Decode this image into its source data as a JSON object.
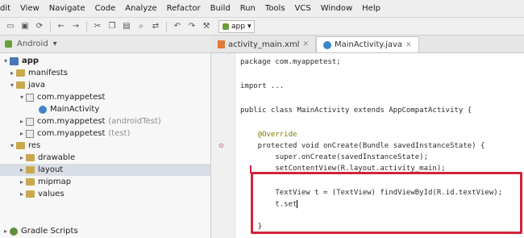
{
  "menu": [
    "dit",
    "View",
    "Navigate",
    "Code",
    "Analyze",
    "Refactor",
    "Build",
    "Run",
    "Tools",
    "VCS",
    "Window",
    "Help"
  ],
  "toolbar": {
    "run_config": "app",
    "icons": [
      "folder-icon",
      "save-icon",
      "refresh-icon",
      "back-icon",
      "forward-icon",
      "cut-icon",
      "copy-icon",
      "paste-icon",
      "find-icon",
      "replace-icon",
      "undo-icon",
      "redo-icon",
      "build-icon"
    ]
  },
  "project_panel": {
    "label": "Android"
  },
  "tabs": [
    {
      "label": "activity_main.xml",
      "active": false
    },
    {
      "label": "MainActivity.java",
      "active": true
    }
  ],
  "tree": [
    {
      "label": "app",
      "indent": 0,
      "icon": "module",
      "bold": true
    },
    {
      "label": "manifests",
      "indent": 1,
      "icon": "folder"
    },
    {
      "label": "java",
      "indent": 1,
      "icon": "folder"
    },
    {
      "label": "com.myappetest",
      "indent": 2,
      "icon": "package"
    },
    {
      "label": "MainActivity",
      "indent": 3,
      "icon": "class"
    },
    {
      "label": "com.myappetest",
      "indent": 2,
      "icon": "package",
      "suffix": "(androidTest)"
    },
    {
      "label": "com.myappetest",
      "indent": 2,
      "icon": "package",
      "suffix": "(test)"
    },
    {
      "label": "res",
      "indent": 1,
      "icon": "folder"
    },
    {
      "label": "drawable",
      "indent": 2,
      "icon": "folder"
    },
    {
      "label": "layout",
      "indent": 2,
      "icon": "folder",
      "selected": true
    },
    {
      "label": "mipmap",
      "indent": 2,
      "icon": "folder"
    },
    {
      "label": "values",
      "indent": 2,
      "icon": "folder"
    },
    {
      "label": "Gradle Scripts",
      "indent": 0,
      "icon": "gradle"
    }
  ],
  "code": [
    "package com.myappetest;",
    "",
    "import ...",
    "",
    "public class MainActivity extends AppCompatActivity {",
    "",
    "    @Override",
    "    protected void onCreate(Bundle savedInstanceState) {",
    "        super.onCreate(savedInstanceState);",
    "        setContentView(R.layout.activity_main);",
    "",
    "        TextView t = (TextView) findViewById(R.id.textView);",
    "        t.set",
    "    }"
  ]
}
